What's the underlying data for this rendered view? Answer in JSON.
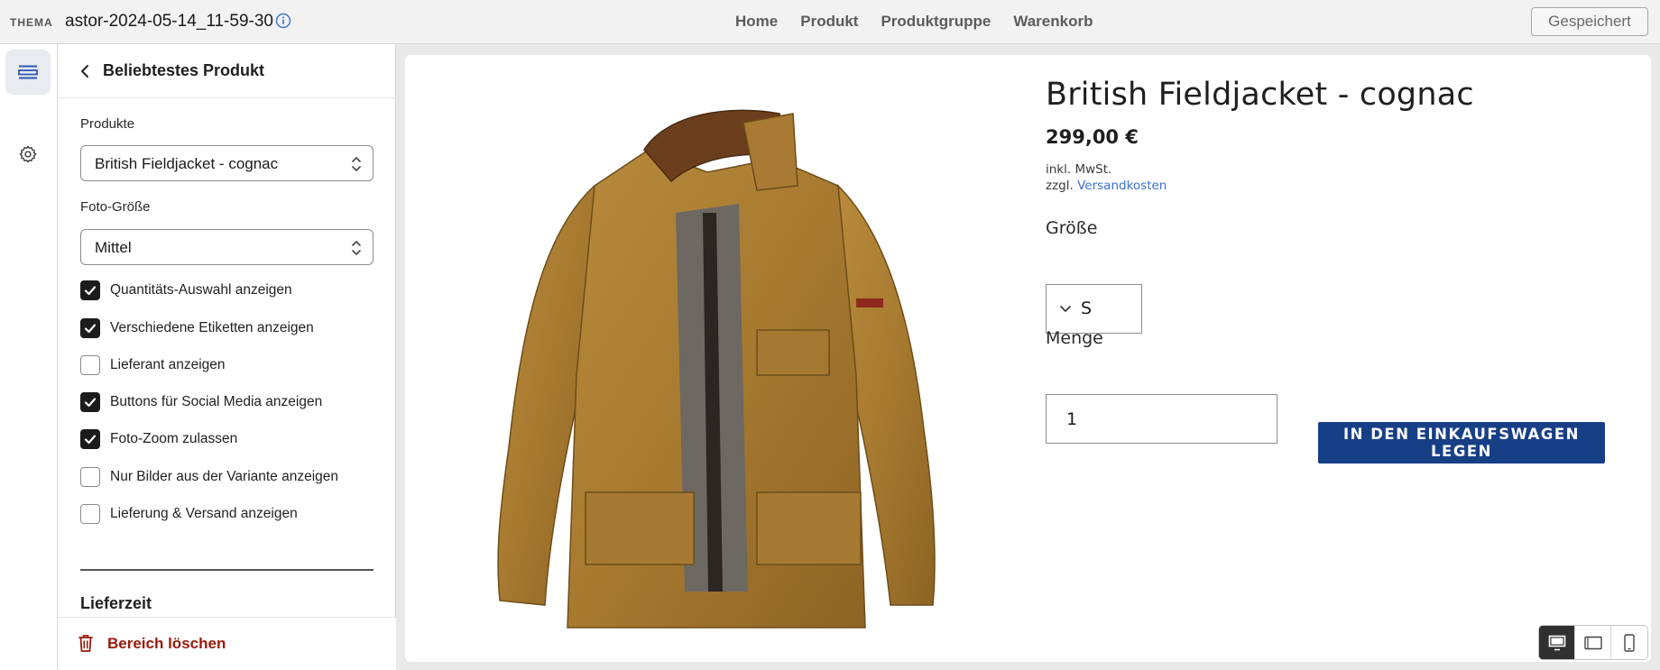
{
  "topbar": {
    "brand": "THEMA",
    "theme_name": "astor-2024-05-14_11-59-30",
    "nav": [
      "Home",
      "Produkt",
      "Produktgruppe",
      "Warenkorb"
    ],
    "saved_label": "Gespeichert"
  },
  "rail": {
    "icons": [
      "sections-icon",
      "gear-icon"
    ]
  },
  "panel": {
    "title": "Beliebtestes Produkt",
    "products_label": "Produkte",
    "products_value": "British Fieldjacket - cognac",
    "photo_size_label": "Foto-Größe",
    "photo_size_value": "Mittel",
    "checkboxes": [
      {
        "label": "Quantitäts-Auswahl anzeigen",
        "checked": true
      },
      {
        "label": "Verschiedene Etiketten anzeigen",
        "checked": true
      },
      {
        "label": "Lieferant anzeigen",
        "checked": false
      },
      {
        "label": "Buttons für Social Media anzeigen",
        "checked": true
      },
      {
        "label": "Foto-Zoom zulassen",
        "checked": true
      },
      {
        "label": "Nur Bilder aus der Variante anzeigen",
        "checked": false
      },
      {
        "label": "Lieferung & Versand anzeigen",
        "checked": false
      }
    ],
    "section_title": "Lieferzeit",
    "delete_label": "Bereich löschen"
  },
  "preview": {
    "product_title": "British Fieldjacket - cognac",
    "price": "299,00 €",
    "tax_note": "inkl. MwSt.",
    "shipping_prefix": "zzgl.",
    "shipping_link": "Versandkosten",
    "size_label": "Größe",
    "size_value": "S",
    "qty_label": "Menge",
    "qty_value": "1",
    "add_to_cart": "IN DEN EINKAUFSWAGEN LEGEN"
  },
  "devices": [
    "desktop-icon",
    "tablet-icon",
    "mobile-icon"
  ],
  "colors": {
    "accent_button": "#173f86",
    "link": "#3a6fd8",
    "danger": "#9a1a0a"
  }
}
